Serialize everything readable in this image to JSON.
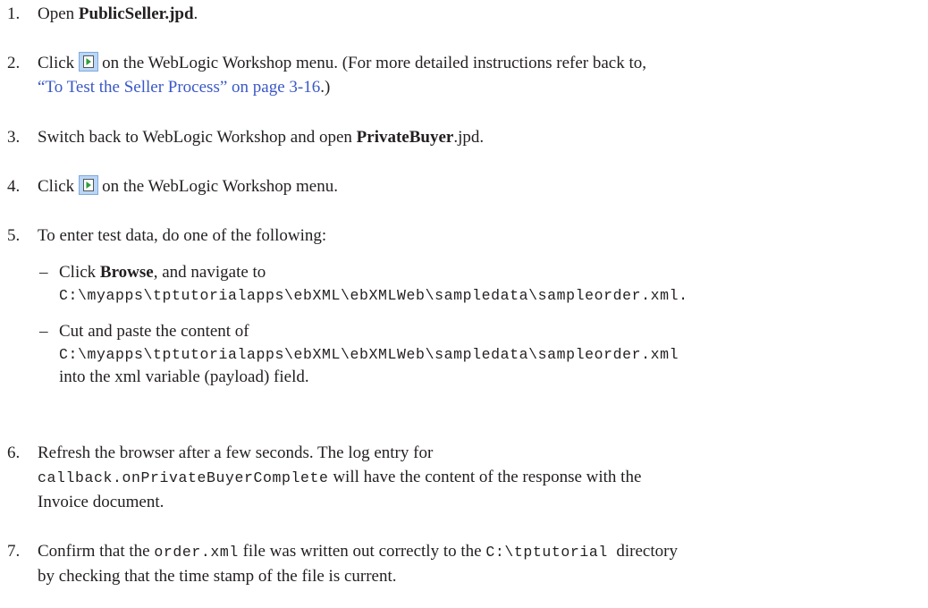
{
  "steps": [
    {
      "number": "1.",
      "pre": "Open ",
      "bold": "PublicSeller.jpd",
      "post": "."
    },
    {
      "number": "2.",
      "pre": "Click",
      "mid": "on the WebLogic Workshop menu. (For more detailed instructions refer back to,",
      "link": "“To Test the Seller Process” on page 3-16",
      "post": ".)"
    },
    {
      "number": "3.",
      "pre": "Switch back to WebLogic Workshop and open ",
      "bold": "PrivateBuyer",
      "post": ".jpd."
    },
    {
      "number": "4.",
      "pre": "Click",
      "post": "on the WebLogic Workshop menu."
    },
    {
      "number": "5.",
      "text": "To enter test data, do one of the following:",
      "bullets": [
        {
          "dash": "–",
          "pre": "Click ",
          "bold": "Browse",
          "post": ", and navigate to",
          "path": "C:\\myapps\\tptutorialapps\\ebXML\\ebXMLWeb\\sampledata\\sampleorder.xml."
        },
        {
          "dash": "–",
          "text": "Cut and paste the content of",
          "path": "C:\\myapps\\tptutorialapps\\ebXML\\ebXMLWeb\\sampledata\\sampleorder.xml",
          "post": "into the xml variable (payload) field."
        }
      ]
    },
    {
      "number": "6.",
      "text": "Refresh the browser after a few seconds. The log entry for",
      "code": "callback.onPrivateBuyerComplete",
      "post": " will have the content of the response with the",
      "post2": "Invoice document."
    },
    {
      "number": "7.",
      "pre": "Confirm that the ",
      "code1": "order.xml",
      "mid": " file was written out correctly to the ",
      "code2": "C:\\tptutorial",
      "post": "  directory",
      "post2": "by checking that the time stamp of the file is current."
    }
  ],
  "icons": {
    "run": "run-test-icon",
    "accent": "#b9d6f6",
    "arrow": "#2e9e3a",
    "link_color": "#3a58c8"
  }
}
